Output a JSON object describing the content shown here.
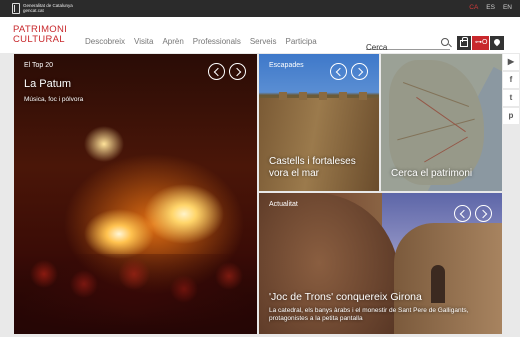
{
  "topbar": {
    "gencat_line1": "Generalitat de Catalunya",
    "gencat_line2": "gencat.cat",
    "languages": [
      "CA",
      "ES",
      "EN"
    ],
    "active_language": "CA"
  },
  "header": {
    "logo_line1": "PATRIMONI",
    "logo_line2": "CULTURAL",
    "nav": [
      "Descobreix",
      "Visita",
      "Aprèn",
      "Professionals",
      "Serveis",
      "Participa"
    ],
    "search_placeholder": "Cerca",
    "compare_label": "⊶O"
  },
  "tiles": {
    "top20": {
      "label": "El Top 20",
      "title": "La Patum",
      "subtitle": "Música, foc i pólvora"
    },
    "escapades": {
      "label": "Escapades",
      "title": "Castells i fortaleses vora el mar"
    },
    "map": {
      "title": "Cerca el patrimoni"
    },
    "actualitat": {
      "label": "Actualitat",
      "title": "'Joc de Trons' conquereix Girona",
      "subtitle": "La catedral, els banys àrabs i el monestir de Sant Pere de Galligants, protagonistes a la petita pantalla"
    }
  },
  "social": [
    "youtube-icon",
    "facebook-icon",
    "twitter-icon",
    "pinterest-icon"
  ],
  "colors": {
    "brand_red": "#c8282c",
    "topbar": "#2b2b2b"
  }
}
